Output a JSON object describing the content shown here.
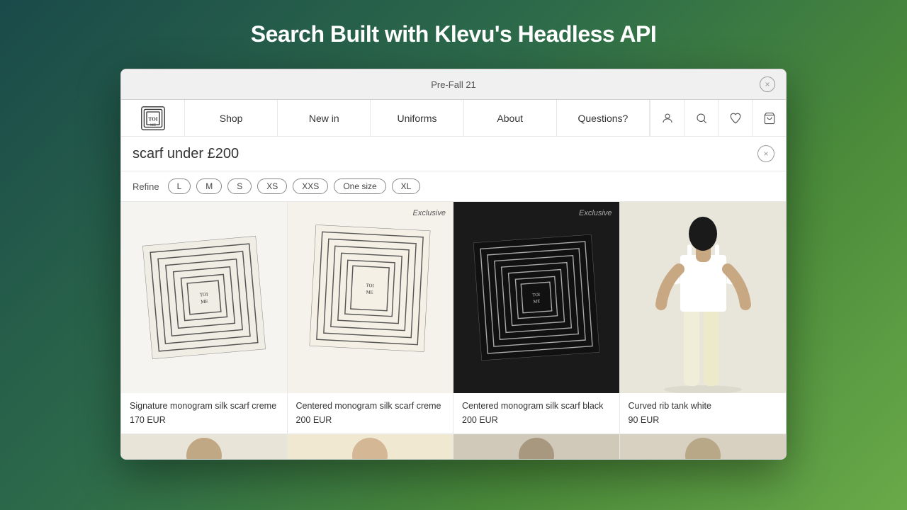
{
  "page": {
    "title": "Search Built with Klevu's Headless API"
  },
  "browser": {
    "tab_label": "Pre-Fall 21",
    "close_label": "×"
  },
  "nav": {
    "logo_alt": "TOI ME brand logo",
    "links": [
      {
        "label": "Shop",
        "id": "shop"
      },
      {
        "label": "New in",
        "id": "new-in"
      },
      {
        "label": "Uniforms",
        "id": "uniforms"
      },
      {
        "label": "About",
        "id": "about"
      },
      {
        "label": "Questions?",
        "id": "questions"
      }
    ],
    "icons": [
      {
        "label": "👤",
        "name": "account-icon"
      },
      {
        "label": "🔍",
        "name": "search-icon"
      },
      {
        "label": "♡",
        "name": "wishlist-icon"
      },
      {
        "label": "🛍",
        "name": "cart-icon"
      }
    ]
  },
  "search": {
    "query": "scarf under £200",
    "clear_label": "×"
  },
  "refine": {
    "label": "Refine",
    "filters": [
      "L",
      "M",
      "S",
      "XS",
      "XXS",
      "One size",
      "XL"
    ]
  },
  "products": [
    {
      "id": 1,
      "name": "Signature monogram silk scarf creme",
      "price": "170 EUR",
      "exclusive": false,
      "bg": "creme",
      "bottom_bg": "light"
    },
    {
      "id": 2,
      "name": "Centered monogram silk scarf creme",
      "price": "200 EUR",
      "exclusive": true,
      "bg": "creme",
      "bottom_bg": "tan"
    },
    {
      "id": 3,
      "name": "Centered monogram silk scarf black",
      "price": "200 EUR",
      "exclusive": true,
      "bg": "dark",
      "bottom_bg": "dark"
    },
    {
      "id": 4,
      "name": "Curved rib tank white",
      "price": "90 EUR",
      "exclusive": false,
      "bg": "model",
      "bottom_bg": "tan"
    }
  ],
  "colors": {
    "background_gradient_start": "#1a4a4a",
    "background_gradient_end": "#6aaa4a",
    "accent": "#333333",
    "border": "#e8e8e8"
  }
}
